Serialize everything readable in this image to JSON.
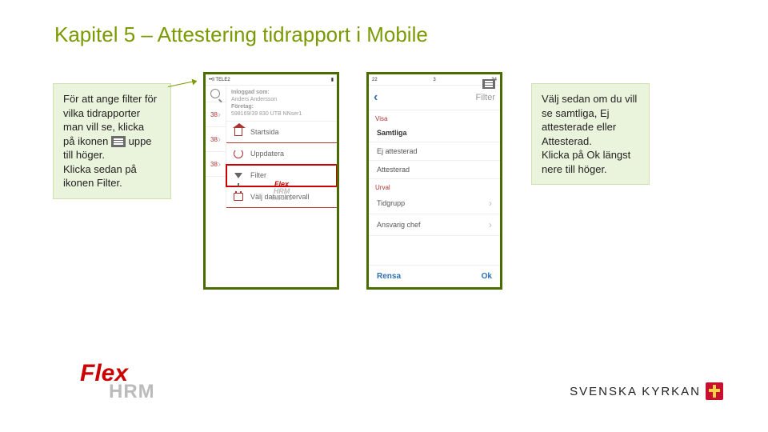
{
  "title": "Kapitel 5 – Attestering tidrapport i Mobile",
  "callout_left": {
    "l1": "För att ange filter för",
    "l2": "vilka tidrapporter",
    "l3": "man vill se, klicka",
    "l4a": "på ikonen ",
    "l4b": " uppe",
    "l5": "till höger.",
    "l6": "Klicka sedan på",
    "l7": "ikonen Filter."
  },
  "callout_right": {
    "l1": "Välj sedan om du vill",
    "l2": "se samtliga, Ej",
    "l3": "attesterade eller",
    "l4": "Attesterad.",
    "l5": "Klicka på Ok längst",
    "l6": "nere till höger."
  },
  "phone_left": {
    "status_carrier": "••ll TELE2",
    "logged_as_label": "Inloggad som:",
    "user_name": "Anders Andersson",
    "company_label": "Företag:",
    "company_value": "598169/39 830 UTB NNser1",
    "menu": {
      "home": "Startsida",
      "update": "Uppdatera",
      "filter": "Filter",
      "date": "Välj datumintervall"
    },
    "list_val": "38",
    "logo_brand": "Flex",
    "logo_sub": "HRM",
    "logo_tag": "mobile"
  },
  "phone_right": {
    "header_title": "Filter",
    "visa_label": "Visa",
    "opt_all": "Samtliga",
    "opt_not": "Ej attesterad",
    "opt_att": "Attesterad",
    "urval_label": "Urval",
    "tidgrupp": "Tidgrupp",
    "ansvarig": "Ansvarig chef",
    "clear": "Rensa",
    "ok": "Ok"
  },
  "flex_logo": {
    "flex": "Flex",
    "hrm": "HRM"
  },
  "sk_logo": "SVENSKA KYRKAN"
}
